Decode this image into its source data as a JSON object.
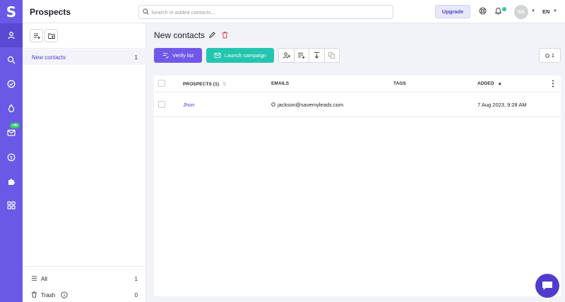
{
  "app": {
    "logo_letter": "S",
    "title": "Prospects"
  },
  "rail": {
    "items": [
      {
        "icon": "person-icon",
        "active": true
      },
      {
        "icon": "search-icon"
      },
      {
        "icon": "check-circle-icon"
      },
      {
        "icon": "flame-icon"
      },
      {
        "icon": "mail-icon",
        "badge": "+AI"
      },
      {
        "icon": "dollar-icon"
      },
      {
        "icon": "puzzle-icon"
      },
      {
        "icon": "grid-icon"
      }
    ],
    "ai_badge": "+AI"
  },
  "topbar": {
    "search_placeholder": "Search in added contacts...",
    "upgrade_label": "Upgrade",
    "avatar_initials": "SA",
    "language": "EN"
  },
  "sidebar": {
    "lists": [
      {
        "label": "New contacts",
        "count": "1"
      }
    ],
    "all_label": "All",
    "all_count": "1",
    "trash_label": "Trash",
    "trash_count": "0"
  },
  "main": {
    "title": "New contacts",
    "verify_label": "Verify list",
    "launch_label": "Launch campaign",
    "count_label": "1"
  },
  "table": {
    "headers": {
      "prospects": "PROSPECTS (1)",
      "emails": "EMAILS",
      "tags": "TAGS",
      "added": "ADDED"
    },
    "rows": [
      {
        "name": "Jhon",
        "email": "jackson@savemyleads.com",
        "tags": "",
        "added": "7 Aug 2023, 9:28 AM"
      }
    ]
  },
  "colors": {
    "brand": "#6a59e6",
    "primary_button": "#7059e8",
    "launch_button": "#23c5b0",
    "chat": "#4f3ccf"
  }
}
